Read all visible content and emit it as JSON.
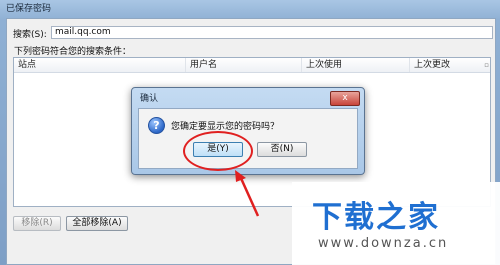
{
  "window": {
    "title": "已保存密码"
  },
  "search": {
    "label": "搜索(S):",
    "value": "mail.qq.com"
  },
  "hint": "下列密码符合您的搜索条件：",
  "table": {
    "columns": [
      "站点",
      "用户名",
      "上次使用",
      "上次更改"
    ],
    "rows": []
  },
  "buttons": {
    "remove": "移除(R)",
    "remove_all": "全部移除(A)"
  },
  "dialog": {
    "title": "确认",
    "close": "x",
    "message": "您确定要显示您的密码吗？",
    "yes": "是(Y)",
    "no": "否(N)"
  },
  "watermark": {
    "logo": "下载之家",
    "url": "www.downza.cn"
  },
  "colors": {
    "annotation": "#e02020",
    "logo": "#1f6fd1"
  }
}
